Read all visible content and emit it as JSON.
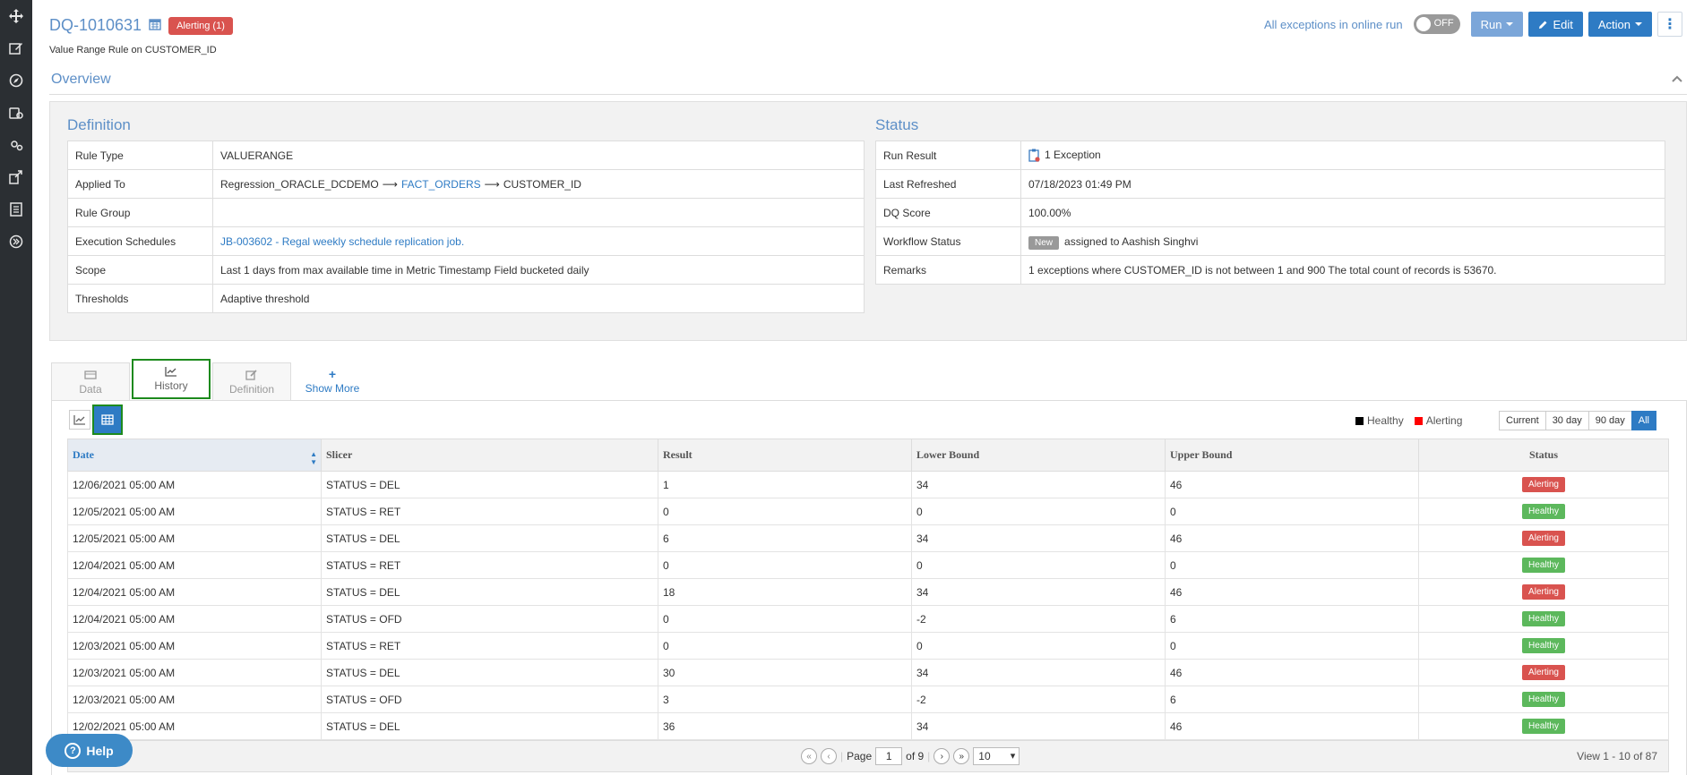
{
  "sidebar": {
    "icons": [
      "move-icon",
      "edit-icon",
      "compass-icon",
      "rules-icon",
      "settings-icon",
      "share-icon",
      "clipboard-icon",
      "expand-icon"
    ]
  },
  "header": {
    "rule_id": "DQ-1010631",
    "alert_badge": "Alerting (1)",
    "subtitle": "Value Range Rule on CUSTOMER_ID",
    "exceptions_label": "All exceptions in online run",
    "toggle_label": "OFF",
    "run_label": "Run",
    "edit_label": "Edit",
    "action_label": "Action"
  },
  "overview": {
    "title": "Overview"
  },
  "definition": {
    "title": "Definition",
    "rule_type_key": "Rule Type",
    "rule_type": "VALUERANGE",
    "applied_to_key": "Applied To",
    "applied_db": "Regression_ORACLE_DCDEMO",
    "arrow": "⟶",
    "applied_table": "FACT_ORDERS",
    "applied_col": "CUSTOMER_ID",
    "rule_group_key": "Rule Group",
    "rule_group": "",
    "exec_key": "Execution Schedules",
    "exec_value": "JB-003602  -  Regal weekly schedule replication job.",
    "scope_key": "Scope",
    "scope": "Last 1 days from max available time in Metric Timestamp Field bucketed daily",
    "thresholds_key": "Thresholds",
    "thresholds": "Adaptive threshold"
  },
  "status": {
    "title": "Status",
    "run_result_key": "Run Result",
    "run_result": "1  Exception",
    "last_refreshed_key": "Last Refreshed",
    "last_refreshed": "07/18/2023 01:49 PM",
    "dq_score_key": "DQ Score",
    "dq_score": "100.00%",
    "workflow_key": "Workflow Status",
    "workflow_badge": "New",
    "workflow_value": "assigned to Aashish Singhvi",
    "remarks_key": "Remarks",
    "remarks": "1 exceptions where CUSTOMER_ID is not between 1 and 900 The total count of records is 53670."
  },
  "tabs": {
    "data": "Data",
    "history": "History",
    "definition": "Definition",
    "more": "Show More"
  },
  "legend": {
    "healthy": "Healthy",
    "alerting": "Alerting",
    "healthy_color": "#000000",
    "alerting_color": "#ff0000"
  },
  "ranges": [
    "Current",
    "30 day",
    "90 day",
    "All"
  ],
  "table": {
    "headers": [
      "Date",
      "Slicer",
      "Result",
      "Lower Bound",
      "Upper Bound",
      "Status"
    ],
    "rows": [
      {
        "date": "12/06/2021 05:00 AM",
        "slicer": "STATUS = DEL",
        "result": "1",
        "lower": "34",
        "upper": "46",
        "status": "Alerting"
      },
      {
        "date": "12/05/2021 05:00 AM",
        "slicer": "STATUS = RET",
        "result": "0",
        "lower": "0",
        "upper": "0",
        "status": "Healthy"
      },
      {
        "date": "12/05/2021 05:00 AM",
        "slicer": "STATUS = DEL",
        "result": "6",
        "lower": "34",
        "upper": "46",
        "status": "Alerting"
      },
      {
        "date": "12/04/2021 05:00 AM",
        "slicer": "STATUS = RET",
        "result": "0",
        "lower": "0",
        "upper": "0",
        "status": "Healthy"
      },
      {
        "date": "12/04/2021 05:00 AM",
        "slicer": "STATUS = DEL",
        "result": "18",
        "lower": "34",
        "upper": "46",
        "status": "Alerting"
      },
      {
        "date": "12/04/2021 05:00 AM",
        "slicer": "STATUS = OFD",
        "result": "0",
        "lower": "-2",
        "upper": "6",
        "status": "Healthy"
      },
      {
        "date": "12/03/2021 05:00 AM",
        "slicer": "STATUS = RET",
        "result": "0",
        "lower": "0",
        "upper": "0",
        "status": "Healthy"
      },
      {
        "date": "12/03/2021 05:00 AM",
        "slicer": "STATUS = DEL",
        "result": "30",
        "lower": "34",
        "upper": "46",
        "status": "Alerting"
      },
      {
        "date": "12/03/2021 05:00 AM",
        "slicer": "STATUS = OFD",
        "result": "3",
        "lower": "-2",
        "upper": "6",
        "status": "Healthy"
      },
      {
        "date": "12/02/2021 05:00 AM",
        "slicer": "STATUS = DEL",
        "result": "36",
        "lower": "34",
        "upper": "46",
        "status": "Healthy"
      }
    ]
  },
  "pager": {
    "page_label": "Page",
    "page": "1",
    "of_label": "of 9",
    "page_size": "10",
    "view_count": "View 1 - 10 of 87"
  },
  "help": {
    "label": "Help"
  },
  "colors": {
    "alerting": "#d9534f",
    "healthy": "#5cb85c",
    "accent": "#2e7bc4"
  }
}
